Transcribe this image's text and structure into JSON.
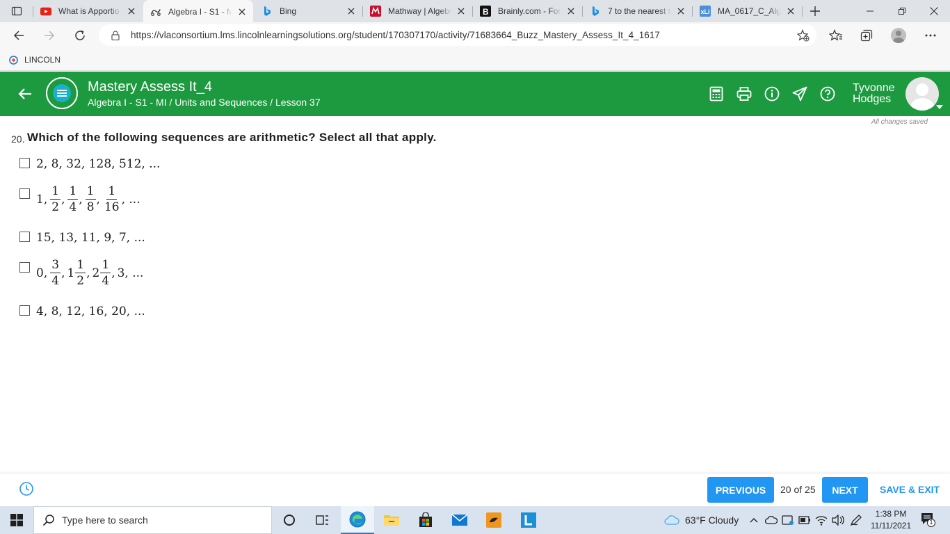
{
  "browser": {
    "tabs": [
      {
        "title": "What is Apportio",
        "icon": "youtube-icon"
      },
      {
        "title": "Algebra I - S1 - M",
        "icon": "lincoln-icon",
        "active": true
      },
      {
        "title": "Bing",
        "icon": "bing-icon"
      },
      {
        "title": "Mathway | Algebr",
        "icon": "mathway-icon"
      },
      {
        "title": "Brainly.com - For",
        "icon": "brainly-icon"
      },
      {
        "title": "7 to the nearest t",
        "icon": "bing-icon"
      },
      {
        "title": "MA_0617_C_Alge",
        "icon": "excel-icon"
      }
    ],
    "url": "https://vlaconsortium.lms.lincolnlearningsolutions.org/student/170307170/activity/71683664_Buzz_Mastery_Assess_It_4_1617",
    "bookmarks": [
      {
        "label": "LINCOLN"
      }
    ]
  },
  "header": {
    "title": "Mastery Assess It_4",
    "breadcrumb": "Algebra I - S1 - MI / Units and Sequences / Lesson 37",
    "user_first": "Tyvonne",
    "user_last": "Hodges",
    "color": "#1d9a3f"
  },
  "status": {
    "saved": "All changes saved"
  },
  "question": {
    "number": "20.",
    "text": "Which of the following sequences are arithmetic? Select all that apply.",
    "options": [
      {
        "text": "2, 8, 32, 128, 512, ...",
        "checked": false
      },
      {
        "text": "1, 1/2, 1/4, 1/8, 1/16, ...",
        "checked": false,
        "parts": {
          "a": "1,",
          "f1n": "1",
          "f1d": "2",
          "f2n": "1",
          "f2d": "4",
          "f3n": "1",
          "f3d": "8",
          "f4n": "1",
          "f4d": "16",
          "tail": ", ..."
        }
      },
      {
        "text": "15, 13, 11, 9, 7, ...",
        "checked": false
      },
      {
        "text": "0, 3/4, 1 1/2, 2 1/4, 3, ...",
        "checked": false,
        "parts": {
          "a": "0,",
          "f1n": "3",
          "f1d": "4",
          "w2": "1",
          "f2n": "1",
          "f2d": "2",
          "w3": "2",
          "f3n": "1",
          "f3d": "4",
          "tail": "3, ..."
        }
      },
      {
        "text": "4, 8, 12, 16, 20, ...",
        "checked": false
      }
    ]
  },
  "footer": {
    "previous": "PREVIOUS",
    "page": "20 of 25",
    "next": "NEXT",
    "save_exit": "SAVE & EXIT",
    "accent": "#2196f3"
  },
  "taskbar": {
    "search_placeholder": "Type here to search",
    "weather": "63°F  Cloudy",
    "time": "1:38 PM",
    "date": "11/11/2021",
    "notification_count": "1"
  }
}
